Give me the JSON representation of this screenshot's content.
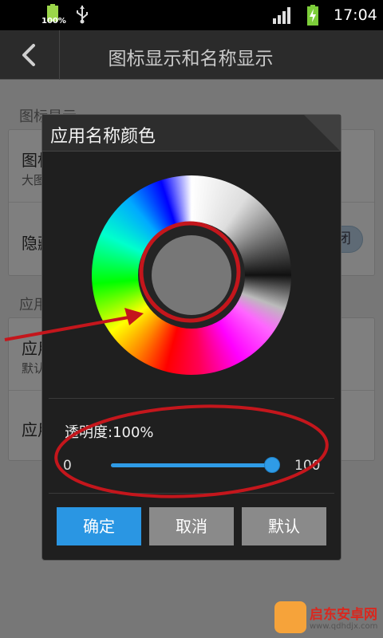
{
  "status_bar": {
    "battery_small_text": "100%",
    "time": "17:04"
  },
  "title_bar": {
    "title": "图标显示和名称显示"
  },
  "background": {
    "section1_header": "图标显示",
    "row_icon_size_title": "图标大小",
    "row_icon_size_value": "大图标",
    "row_hide_icon_title": "隐藏图标",
    "row_hide_icon_toggle": "关闭",
    "section2_header": "应用名称",
    "row_name_size_title": "应用名称大小",
    "row_name_size_value": "默认大小",
    "row_name_color_title": "应用名称颜色"
  },
  "dialog": {
    "title": "应用名称颜色",
    "opacity_label": "透明度:100%",
    "slider_min": "0",
    "slider_max": "100",
    "opacity_value": 1.0,
    "buttons": {
      "ok": "确定",
      "cancel": "取消",
      "default": "默认"
    }
  },
  "colors": {
    "accent": "#2a96e3",
    "annotation": "#c4161c",
    "selected_color": "#777777"
  },
  "watermark": {
    "name": "启东安卓网",
    "url": "www.qdhdjx.com"
  }
}
